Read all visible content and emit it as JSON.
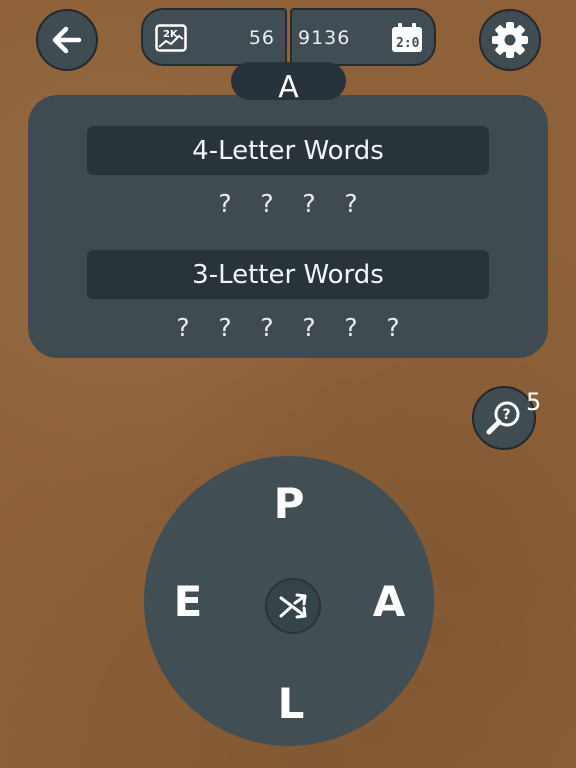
{
  "header": {
    "back_icon": "arrow-left-icon",
    "score_icon": "2k-chart-icon",
    "score_value": "56",
    "daily_value": "9136",
    "daily_icon": "calendar-clock-icon",
    "settings_icon": "gear-icon",
    "current_word": "A"
  },
  "categories": [
    {
      "title": "4-Letter Words",
      "slots": [
        "?",
        "?",
        "?",
        "?"
      ]
    },
    {
      "title": "3-Letter Words",
      "slots": [
        "?",
        "?",
        "?",
        "?",
        "?",
        "?"
      ]
    }
  ],
  "hint": {
    "icon": "magnifier-question-icon",
    "count": "5"
  },
  "wheel": {
    "letters": {
      "top": "P",
      "left": "E",
      "right": "A",
      "bottom": "L"
    },
    "shuffle_icon": "shuffle-icon"
  },
  "colors": {
    "background": "#8e6138",
    "panel": "#3f4b51",
    "category_bar": "#29343a",
    "text": "#ffffff"
  }
}
